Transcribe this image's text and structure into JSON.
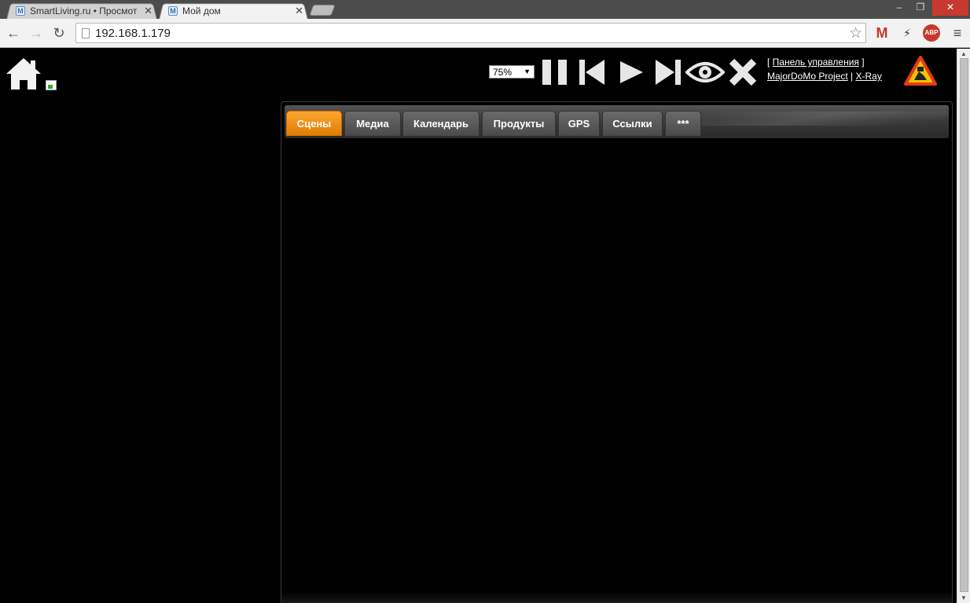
{
  "browser": {
    "tabs": [
      {
        "title": "SmartLiving.ru • Просмот",
        "favicon": "M",
        "active": false
      },
      {
        "title": "Мой дом",
        "favicon": "M",
        "active": true
      }
    ],
    "url": "192.168.1.179",
    "window_controls": {
      "minimize": "‒",
      "maximize": "❐",
      "close": "✕"
    }
  },
  "page": {
    "zoom": {
      "value": "75%"
    },
    "controls": [
      "pause-icon",
      "previous-icon",
      "play-icon",
      "next-icon",
      "eye-icon",
      "stop-icon"
    ],
    "links": {
      "control_panel": "Панель управления",
      "project": "MajorDoMo Project",
      "xray": "X-Ray"
    },
    "tabs": [
      {
        "label": "Сцены",
        "active": true
      },
      {
        "label": "Медиа"
      },
      {
        "label": "Календарь"
      },
      {
        "label": "Продукты"
      },
      {
        "label": "GPS"
      },
      {
        "label": "Ссылки"
      },
      {
        "label": "***"
      }
    ],
    "colors": {
      "active_tab": "#f28a00",
      "background": "#000000"
    }
  }
}
